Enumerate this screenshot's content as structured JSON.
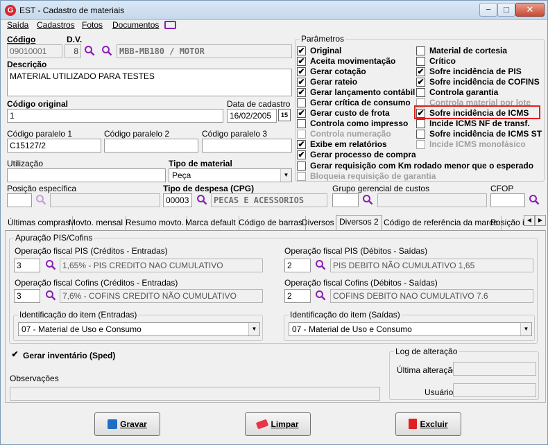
{
  "window": {
    "title": "EST - Cadastro de materiais",
    "logo_letter": "G",
    "minimize": "−",
    "maximize": "□",
    "close": "✕"
  },
  "menu": [
    "Saída",
    "Cadastros",
    "Fotos",
    "Documentos"
  ],
  "form": {
    "codigo_label": "Código",
    "codigo_value": "09010001",
    "dv_label": "D.V.",
    "dv_value": "8",
    "grupo_value": "MBB-MB180 / MOTOR",
    "descricao_label": "Descrição",
    "descricao_value": "MATERIAL UTILIZADO PARA TESTES",
    "codigo_original_label": "Código original",
    "codigo_original_value": "1",
    "data_cadastro_label": "Data de cadastro",
    "data_cadastro_value": "16/02/2005",
    "calendar_label": "15",
    "paralelo1_label": "Código paralelo 1",
    "paralelo1_value": "C15127/2",
    "paralelo2_label": "Código paralelo 2",
    "paralelo2_value": "",
    "paralelo3_label": "Código paralelo 3",
    "paralelo3_value": "",
    "utilizacao_label": "Utilização",
    "utilizacao_value": "",
    "tipo_material_label": "Tipo de material",
    "tipo_material_value": "Peça",
    "posicao_label": "Posição específica",
    "posicao_value": "",
    "tipo_despesa_label": "Tipo de despesa (CPG)",
    "tipo_despesa_code": "00003",
    "tipo_despesa_desc": "PECAS E ACESSORIOS",
    "grupo_gerencial_label": "Grupo gerencial de custos",
    "grupo_gerencial_value": "",
    "cfop_label": "CFOP",
    "cfop_value": ""
  },
  "parametros": {
    "title": "Parâmetros",
    "left": [
      {
        "label": "Original",
        "checked": true,
        "enabled": true
      },
      {
        "label": "Aceita movimentação",
        "checked": true,
        "enabled": true
      },
      {
        "label": "Gerar cotação",
        "checked": true,
        "enabled": true
      },
      {
        "label": "Gerar rateio",
        "checked": true,
        "enabled": true
      },
      {
        "label": "Gerar lançamento contábil",
        "checked": true,
        "enabled": true
      },
      {
        "label": "Gerar crítica de consumo",
        "checked": false,
        "enabled": true
      },
      {
        "label": "Gerar custo de frota",
        "checked": true,
        "enabled": true
      },
      {
        "label": "Controla como impresso",
        "checked": false,
        "enabled": true
      },
      {
        "label": "Controla numeração",
        "checked": false,
        "enabled": false
      },
      {
        "label": "Exibe em relatórios",
        "checked": true,
        "enabled": true
      },
      {
        "label": "Gerar processo de compra",
        "checked": true,
        "enabled": true
      }
    ],
    "right": [
      {
        "label": "Material de cortesia",
        "checked": false,
        "enabled": true
      },
      {
        "label": "Crítico",
        "checked": false,
        "enabled": true
      },
      {
        "label": "Sofre incidência de PIS",
        "checked": true,
        "enabled": true
      },
      {
        "label": "Sofre incidência de COFINS",
        "checked": true,
        "enabled": true
      },
      {
        "label": "Controla garantia",
        "checked": false,
        "enabled": true
      },
      {
        "label": "Controla material por lote",
        "checked": false,
        "enabled": false
      },
      {
        "label": "Sofre incidência de ICMS",
        "checked": true,
        "enabled": true
      },
      {
        "label": "Incide ICMS NF de transf.",
        "checked": false,
        "enabled": true
      },
      {
        "label": "Sofre incidência de ICMS ST",
        "checked": false,
        "enabled": true
      },
      {
        "label": "Incide ICMS monofásico",
        "checked": false,
        "enabled": false
      }
    ],
    "wide": [
      {
        "label": "Gerar requisição com Km rodado menor que o esperado",
        "checked": false,
        "enabled": true
      },
      {
        "label": "Bloqueia requisição de garantia",
        "checked": false,
        "enabled": false
      }
    ]
  },
  "tabs": [
    "Últimas compras",
    "Movto. mensal",
    "Resumo movto.",
    "Marca default",
    "Código de barras",
    "Diversos",
    "Diversos 2",
    "Código de referência da marca",
    "Posição i"
  ],
  "active_tab": "Diversos 2",
  "pis_cofins": {
    "title": "Apuração PIS/Cofins",
    "op_pis_cred_label": "Operação fiscal PIS (Créditos - Entradas)",
    "op_pis_cred_code": "3",
    "op_pis_cred_desc": "1,65% - PIS CREDITO NAO CUMULATIVO",
    "op_pis_deb_label": "Operação fiscal PIS (Débitos - Saídas)",
    "op_pis_deb_code": "2",
    "op_pis_deb_desc": "PIS DEBITO NÃO CUMULATIVO  1,65",
    "op_cof_cred_label": "Operação fiscal Cofins (Créditos - Entradas)",
    "op_cof_cred_code": "3",
    "op_cof_cred_desc": "7,6% - COFINS  CREDITO NÃO CUMULATIVO",
    "op_cof_deb_label": "Operação fiscal Cofins (Débitos - Saídas)",
    "op_cof_deb_code": "2",
    "op_cof_deb_desc": "COFINS DEBITO NAO CUMULATIVO 7.6",
    "ident_ent_title": "Identificação do item (Entradas)",
    "ident_ent_value": "07 - Material de Uso e Consumo",
    "ident_sai_title": "Identificação do item (Saídas)",
    "ident_sai_value": "07 - Material de Uso e Consumo"
  },
  "sped": {
    "label": "Gerar inventário (Sped)",
    "checked": true
  },
  "observacoes_label": "Observações",
  "log": {
    "title": "Log de alteração",
    "ultima_label": "Última alteração",
    "usuario_label": "Usuário"
  },
  "buttons": {
    "gravar": "Gravar",
    "limpar": "Limpar",
    "excluir": "Excluir"
  },
  "check_glyph": "✔",
  "colors": {
    "search_icon": "#8b1fb5",
    "highlight": "#e0201e",
    "excluir_icon": "#e02020",
    "gravar_icon": "#1e6fc4"
  }
}
